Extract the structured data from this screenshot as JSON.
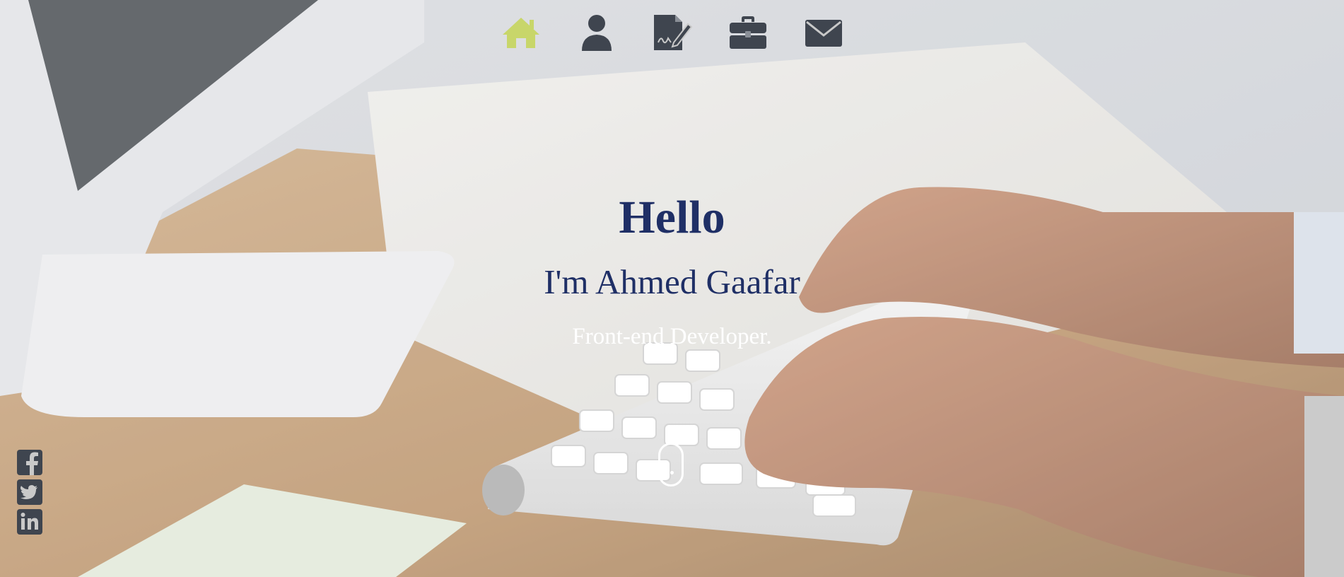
{
  "colors": {
    "accent_active": "#c8d66a",
    "icon_default": "#3f454f",
    "heading": "#1f2f66",
    "subheading_white": "#ffffff"
  },
  "nav": {
    "items": [
      {
        "icon": "home-icon",
        "label": "Home",
        "active": true
      },
      {
        "icon": "user-icon",
        "label": "About",
        "active": false
      },
      {
        "icon": "resume-icon",
        "label": "Resume",
        "active": false
      },
      {
        "icon": "briefcase-icon",
        "label": "Portfolio",
        "active": false
      },
      {
        "icon": "envelope-icon",
        "label": "Contact",
        "active": false
      }
    ]
  },
  "hero": {
    "greeting": "Hello",
    "name_line": "I'm Ahmed Gaafar",
    "role": "Front-end Developer."
  },
  "scroll_indicator": {
    "icon": "mouse-scroll-icon"
  },
  "social": [
    {
      "icon": "facebook-icon",
      "network": "Facebook"
    },
    {
      "icon": "twitter-icon",
      "network": "Twitter"
    },
    {
      "icon": "linkedin-icon",
      "network": "LinkedIn"
    }
  ]
}
